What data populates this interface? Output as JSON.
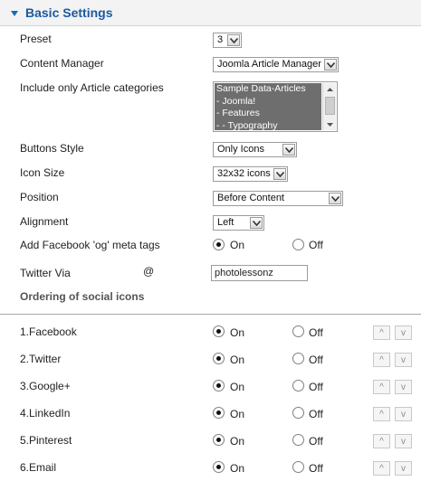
{
  "header": {
    "title": "Basic Settings"
  },
  "fields": {
    "preset": {
      "label": "Preset",
      "value": "3"
    },
    "content_manager": {
      "label": "Content Manager",
      "value": "Joomla Article Manager"
    },
    "categories": {
      "label": "Include only Article categories",
      "options": [
        "Sample Data-Articles",
        "- Joomla!",
        "- Features",
        "- - Typography"
      ]
    },
    "buttons_style": {
      "label": "Buttons Style",
      "value": "Only Icons"
    },
    "icon_size": {
      "label": "Icon Size",
      "value": "32x32 icons"
    },
    "position": {
      "label": "Position",
      "value": "Before Content"
    },
    "alignment": {
      "label": "Alignment",
      "value": "Left"
    },
    "og_tags": {
      "label": "Add Facebook 'og' meta tags",
      "on": "On",
      "off": "Off",
      "selected": "On"
    },
    "twitter_via": {
      "label": "Twitter Via",
      "at": "@",
      "value": "photolessonz"
    }
  },
  "ordering": {
    "title": "Ordering of social icons",
    "on_label": "On",
    "off_label": "Off",
    "up": "^",
    "down": "v",
    "items": [
      {
        "label": "1.Facebook",
        "selected": "On"
      },
      {
        "label": "2.Twitter",
        "selected": "On"
      },
      {
        "label": "3.Google+",
        "selected": "On"
      },
      {
        "label": "4.LinkedIn",
        "selected": "On"
      },
      {
        "label": "5.Pinterest",
        "selected": "On"
      },
      {
        "label": "6.Email",
        "selected": "On"
      }
    ]
  },
  "colors": {
    "accent": "#1b5aa0",
    "header_bg": "#f3f3f3",
    "list_selected_bg": "#6e6e6e"
  }
}
